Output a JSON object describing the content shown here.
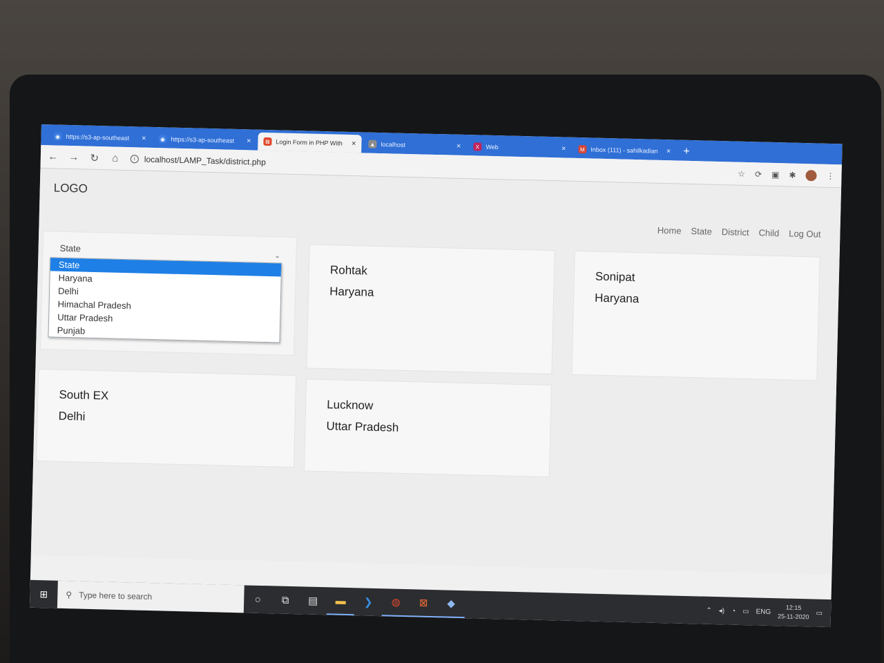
{
  "browser": {
    "tabs": [
      {
        "label": "https://s3-ap-southeast",
        "icon": "globe-icon",
        "color": "#2f6fd6"
      },
      {
        "label": "https://s3-ap-southeast",
        "icon": "globe-icon",
        "color": "#2f6fd6"
      },
      {
        "label": "Login Form in PHP With",
        "icon": "xampp-icon",
        "color": "#e0482d"
      },
      {
        "label": "localhost",
        "icon": "localhost-icon",
        "color": "#a0a0a0"
      },
      {
        "label": "Web",
        "icon": "xd-icon",
        "color": "#c0245c"
      },
      {
        "label": "Inbox (111) - sahilkadian",
        "icon": "gmail-icon",
        "color": "#d44638"
      }
    ],
    "active_tab": 2,
    "url": "localhost/LAMP_Task/district.php"
  },
  "page": {
    "logo": "LOGO",
    "nav": [
      "Home",
      "State",
      "District",
      "Child",
      "Log Out"
    ],
    "filter": {
      "label": "State",
      "options": [
        "State",
        "Haryana",
        "Delhi",
        "Himachal Pradesh",
        "Uttar Pradesh",
        "Punjab"
      ],
      "selected": "State"
    },
    "cards": [
      {
        "district": "Rohtak",
        "state": "Haryana"
      },
      {
        "district": "Sonipat",
        "state": "Haryana"
      },
      {
        "district": "South EX",
        "state": "Delhi"
      },
      {
        "district": "Lucknow",
        "state": "Uttar Pradesh"
      }
    ]
  },
  "taskbar": {
    "search_placeholder": "Type here to search",
    "language": "ENG",
    "time": "12:15",
    "date": "25-11-2020"
  }
}
